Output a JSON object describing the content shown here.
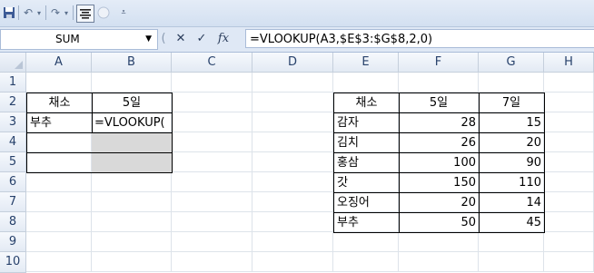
{
  "toolbar": {
    "save_icon": "save-icon",
    "undo_icon": "undo-icon",
    "redo_icon": "redo-icon",
    "align_icon": "align-center-icon",
    "circle_icon": "circle-icon",
    "customize_icon": "customize-dropdown-icon"
  },
  "formula_bar": {
    "name_box": "SUM",
    "cancel_symbol": "✕",
    "enter_symbol": "✓",
    "fx_symbol": "fx",
    "formula": "=VLOOKUP(A3,$E$3:$G$8,2,0)"
  },
  "columns": [
    "A",
    "B",
    "C",
    "D",
    "E",
    "F",
    "G",
    "H"
  ],
  "rows": [
    "1",
    "2",
    "3",
    "4",
    "5",
    "6",
    "7",
    "8",
    "9",
    "10"
  ],
  "cells": {
    "A2": "채소",
    "B2": "5일",
    "A3": "부추",
    "B3": "=VLOOKUP(",
    "E2": "채소",
    "F2": "5일",
    "G2": "7일",
    "E3": "감자",
    "F3": "28",
    "G3": "15",
    "E4": "김치",
    "F4": "26",
    "G4": "20",
    "E5": "홍삼",
    "F5": "100",
    "G5": "90",
    "E6": "갓",
    "F6": "150",
    "G6": "110",
    "E7": "오징어",
    "F7": "20",
    "G7": "14",
    "E8": "부추",
    "F8": "50",
    "G8": "45"
  },
  "colors": {
    "selected_fill": "#d9d9d9",
    "header_text": "#27416b"
  }
}
